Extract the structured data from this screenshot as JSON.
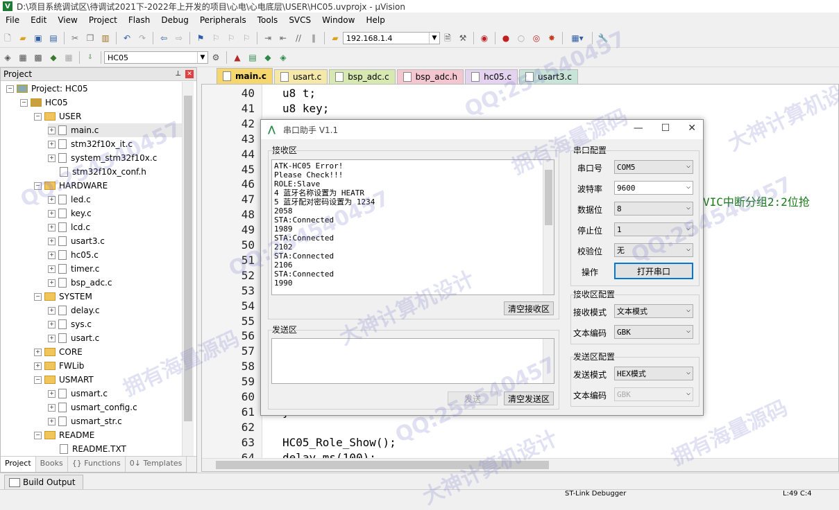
{
  "window": {
    "title": "D:\\项目系统调试区\\待调试2021下-2022年上开发的项目\\心电\\心电底层\\USER\\HC05.uvprojx - µVision",
    "logo": "V"
  },
  "menu": [
    "File",
    "Edit",
    "View",
    "Project",
    "Flash",
    "Debug",
    "Peripherals",
    "Tools",
    "SVCS",
    "Window",
    "Help"
  ],
  "toolbar": {
    "ip_value": "192.168.1.4",
    "target_value": "HC05"
  },
  "project_panel": {
    "title": "Project",
    "tree": [
      {
        "label": "Project: HC05",
        "level": 0,
        "type": "root"
      },
      {
        "label": "HC05",
        "level": 1,
        "type": "target"
      },
      {
        "label": "USER",
        "level": 2,
        "type": "folder"
      },
      {
        "label": "main.c",
        "level": 3,
        "type": "file"
      },
      {
        "label": "stm32f10x_it.c",
        "level": 3,
        "type": "file"
      },
      {
        "label": "system_stm32f10x.c",
        "level": 3,
        "type": "file"
      },
      {
        "label": "stm32f10x_conf.h",
        "level": 3,
        "type": "file"
      },
      {
        "label": "HARDWARE",
        "level": 2,
        "type": "folder"
      },
      {
        "label": "led.c",
        "level": 3,
        "type": "file"
      },
      {
        "label": "key.c",
        "level": 3,
        "type": "file"
      },
      {
        "label": "lcd.c",
        "level": 3,
        "type": "file"
      },
      {
        "label": "usart3.c",
        "level": 3,
        "type": "file"
      },
      {
        "label": "hc05.c",
        "level": 3,
        "type": "file"
      },
      {
        "label": "timer.c",
        "level": 3,
        "type": "file"
      },
      {
        "label": "bsp_adc.c",
        "level": 3,
        "type": "file"
      },
      {
        "label": "SYSTEM",
        "level": 2,
        "type": "folder"
      },
      {
        "label": "delay.c",
        "level": 3,
        "type": "file"
      },
      {
        "label": "sys.c",
        "level": 3,
        "type": "file"
      },
      {
        "label": "usart.c",
        "level": 3,
        "type": "file"
      },
      {
        "label": "CORE",
        "level": 2,
        "type": "folder"
      },
      {
        "label": "FWLib",
        "level": 2,
        "type": "folder"
      },
      {
        "label": "USMART",
        "level": 2,
        "type": "folder"
      },
      {
        "label": "usmart.c",
        "level": 3,
        "type": "file"
      },
      {
        "label": "usmart_config.c",
        "level": 3,
        "type": "file"
      },
      {
        "label": "usmart_str.c",
        "level": 3,
        "type": "file"
      },
      {
        "label": "README",
        "level": 2,
        "type": "folder"
      },
      {
        "label": "README.TXT",
        "level": 3,
        "type": "file"
      }
    ],
    "bottom_tabs": [
      "Project",
      "Books",
      "{} Functions",
      "0↓ Templates"
    ]
  },
  "editor": {
    "tabs": [
      {
        "label": "main.c",
        "color": "#f5d76e",
        "active": true
      },
      {
        "label": "usart.c",
        "color": "#f4e9a8"
      },
      {
        "label": "bsp_adc.c",
        "color": "#d7e8b0"
      },
      {
        "label": "bsp_adc.h",
        "color": "#f4c7d0"
      },
      {
        "label": "hc05.c",
        "color": "#e3d3ef"
      },
      {
        "label": "usart3.c",
        "color": "#c8e3d8"
      }
    ],
    "lines": [
      {
        "n": "40",
        "code": "u8 t;"
      },
      {
        "n": "41",
        "code": "u8 key;"
      },
      {
        "n": "42",
        "code": ""
      },
      {
        "n": "43",
        "code": ""
      },
      {
        "n": "44",
        "code": ""
      },
      {
        "n": "45",
        "code": ""
      },
      {
        "n": "46",
        "code": ""
      },
      {
        "n": "47",
        "code": ""
      },
      {
        "n": "48",
        "code": ""
      },
      {
        "n": "49",
        "code": ""
      },
      {
        "n": "50",
        "code": ""
      },
      {
        "n": "51",
        "code": ""
      },
      {
        "n": "52",
        "code": ""
      },
      {
        "n": "53",
        "code": ""
      },
      {
        "n": "54",
        "code": ""
      },
      {
        "n": "55",
        "code": ""
      },
      {
        "n": "56",
        "code": ""
      },
      {
        "n": "57",
        "code": ""
      },
      {
        "n": "58",
        "code": ""
      },
      {
        "n": "59",
        "code": ""
      },
      {
        "n": "60",
        "code": ""
      },
      {
        "n": "61",
        "code": "}"
      },
      {
        "n": "62",
        "code": ""
      },
      {
        "n": "63",
        "code": "HC05_Role_Show();"
      },
      {
        "n": "64",
        "code": "delay_ms(100);"
      }
    ],
    "comment_fragment": "VIC中断分组2:2位抢"
  },
  "dialog": {
    "title": "串口助手 V1.1",
    "recv_group": "接收区",
    "recv_lines": [
      "ATK-HC05 Error!",
      "Please Check!!!",
      "ROLE:Slave",
      "4 蓝牙名称设置为 HEATR",
      "5 蓝牙配对密码设置为 1234",
      "2058",
      "STA:Connected",
      "1989",
      "STA:Connected",
      "2102",
      "STA:Connected",
      "2106",
      "STA:Connected",
      "1990"
    ],
    "clear_recv": "清空接收区",
    "send_group": "发送区",
    "send_button": "发送",
    "clear_send": "清空发送区",
    "serial_cfg": {
      "title": "串口配置",
      "port_label": "串口号",
      "port_value": "COM5",
      "baud_label": "波特率",
      "baud_value": "9600",
      "data_label": "数据位",
      "data_value": "8",
      "stop_label": "停止位",
      "stop_value": "1",
      "parity_label": "校验位",
      "parity_value": "无",
      "op_label": "操作",
      "open_button": "打开串口"
    },
    "recv_cfg": {
      "title": "接收区配置",
      "mode_label": "接收模式",
      "mode_value": "文本模式",
      "enc_label": "文本编码",
      "enc_value": "GBK"
    },
    "send_cfg": {
      "title": "发送区配置",
      "mode_label": "发送模式",
      "mode_value": "HEX模式",
      "enc_label": "文本编码",
      "enc_value": "GBK"
    }
  },
  "build_output": {
    "label": "Build Output"
  },
  "status": {
    "debugger": "ST-Link Debugger",
    "position": "L:49 C:4"
  },
  "watermarks": [
    "拥有海量源码",
    "QQ:254540457",
    "大神计算机设计"
  ]
}
